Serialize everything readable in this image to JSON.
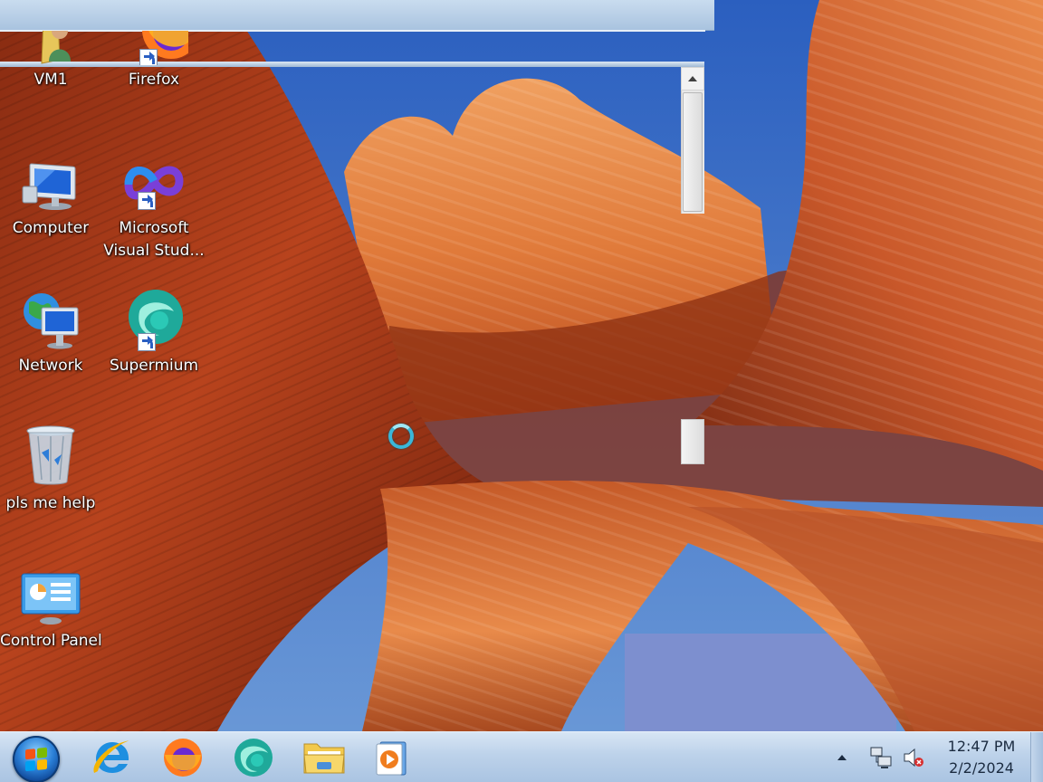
{
  "desktop": {
    "icons": [
      {
        "name": "VM1",
        "icon": "user-folder-icon"
      },
      {
        "name": "Firefox",
        "icon": "firefox-icon"
      },
      {
        "name": "Computer",
        "icon": "computer-icon"
      },
      {
        "name": "Microsoft Visual Stud...",
        "icon": "visual-studio-icon"
      },
      {
        "name": "Network",
        "icon": "network-icon"
      },
      {
        "name": "Supermium",
        "icon": "supermium-icon"
      },
      {
        "name": "pls me help",
        "icon": "recycle-bin-icon"
      },
      {
        "name": "Control Panel",
        "icon": "control-panel-icon"
      }
    ],
    "labels": {
      "vm1": "VM1",
      "firefox": "Firefox",
      "computer": "Computer",
      "vs_line1": "Microsoft",
      "vs_line2": "Visual Stud...",
      "network": "Network",
      "supermium": "Supermium",
      "recycle": "pls me help",
      "control_panel": "Control Panel"
    }
  },
  "taskbar": {
    "start": "start-orb-icon",
    "pinned": [
      "internet-explorer-icon",
      "firefox-icon",
      "supermium-icon",
      "file-explorer-icon",
      "media-player-icon"
    ],
    "tray": [
      "show-hidden-icons-icon",
      "network-icon",
      "volume-muted-icon"
    ],
    "clock": {
      "time": "12:47 PM",
      "date": "2/2/2024"
    }
  },
  "colors": {
    "taskbar": "#bdd2ea",
    "sky": "#3a6fc4",
    "rock": "#d0552a"
  }
}
